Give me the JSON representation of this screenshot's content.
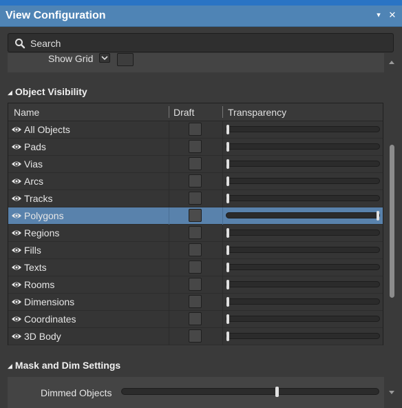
{
  "window": {
    "title": "View Configuration",
    "menu_icon": "▾",
    "close_icon": "✕"
  },
  "search": {
    "placeholder": "Search"
  },
  "grid": {
    "label": "Show Grid"
  },
  "object_visibility": {
    "heading": "Object Visibility",
    "columns": {
      "name": "Name",
      "draft": "Draft",
      "transparency": "Transparency"
    },
    "rows": [
      {
        "name": "All Objects",
        "transparency": 0,
        "selected": false
      },
      {
        "name": "Pads",
        "transparency": 0,
        "selected": false
      },
      {
        "name": "Vias",
        "transparency": 0,
        "selected": false
      },
      {
        "name": "Arcs",
        "transparency": 0,
        "selected": false
      },
      {
        "name": "Tracks",
        "transparency": 0,
        "selected": false
      },
      {
        "name": "Polygons",
        "transparency": 1,
        "selected": true
      },
      {
        "name": "Regions",
        "transparency": 0,
        "selected": false
      },
      {
        "name": "Fills",
        "transparency": 0,
        "selected": false
      },
      {
        "name": "Texts",
        "transparency": 0,
        "selected": false
      },
      {
        "name": "Rooms",
        "transparency": 0,
        "selected": false
      },
      {
        "name": "Dimensions",
        "transparency": 0,
        "selected": false
      },
      {
        "name": "Coordinates",
        "transparency": 0,
        "selected": false
      },
      {
        "name": "3D Body",
        "transparency": 0,
        "selected": false
      }
    ]
  },
  "mask_dim": {
    "heading": "Mask and Dim Settings",
    "dimmed_label": "Dimmed Objects",
    "dimmed_value": 0.6
  },
  "colors": {
    "accent": "#4f84b5",
    "selection": "#5982ac",
    "background": "#3a3a3a"
  }
}
